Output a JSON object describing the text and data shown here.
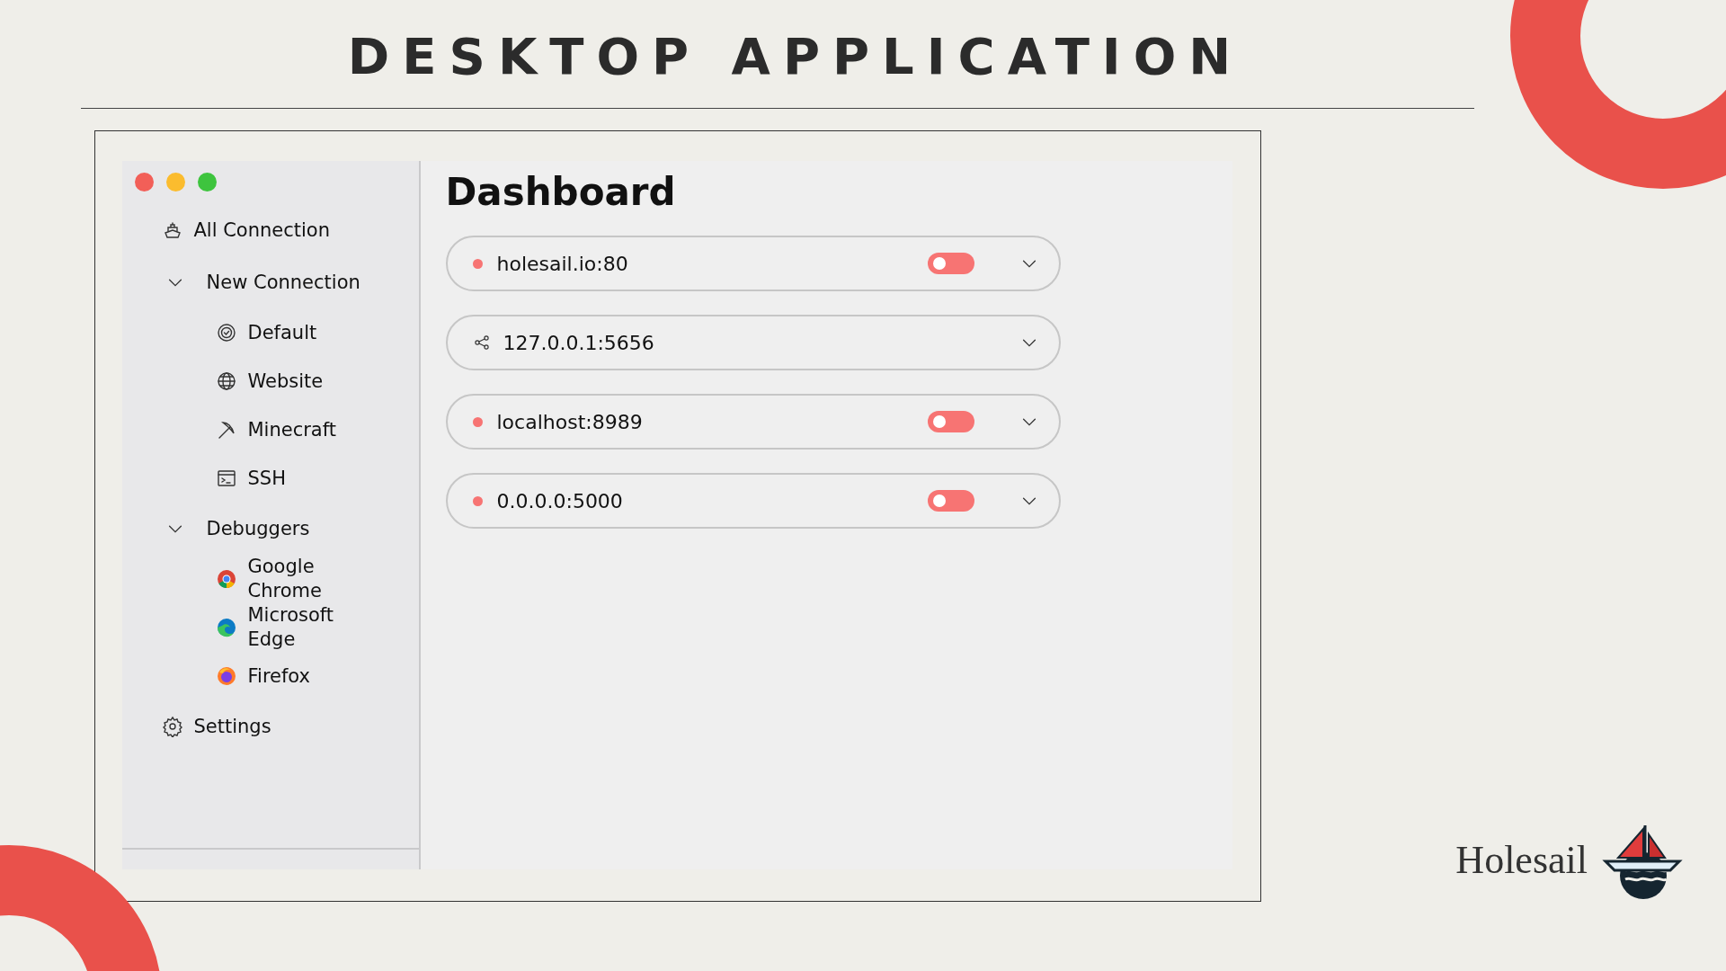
{
  "slide_title": "DESKTOP APPLICATION",
  "window": {
    "traffic_lights": [
      {
        "color": "#f25f58"
      },
      {
        "color": "#fbbc2e"
      },
      {
        "color": "#3ec43e"
      }
    ]
  },
  "sidebar": {
    "items": [
      {
        "label": "All Connection",
        "kind": "link"
      },
      {
        "label": "New Connection",
        "kind": "group",
        "expanded": true,
        "children": [
          {
            "label": "Default"
          },
          {
            "label": "Website"
          },
          {
            "label": "Minecraft"
          },
          {
            "label": "SSH"
          }
        ]
      },
      {
        "label": "Debuggers",
        "kind": "group",
        "expanded": true,
        "children": [
          {
            "label": "Google Chrome"
          },
          {
            "label": "Microsoft Edge"
          },
          {
            "label": "Firefox"
          }
        ]
      },
      {
        "label": "Settings",
        "kind": "link"
      }
    ]
  },
  "dashboard": {
    "title": "Dashboard",
    "connections": [
      {
        "address": "holesail.io:80",
        "kind": "toggle",
        "color": "#f77473",
        "on": false
      },
      {
        "address": "127.0.0.1:5656",
        "kind": "shared"
      },
      {
        "address": "localhost:8989",
        "kind": "toggle",
        "color": "#f77473",
        "on": false
      },
      {
        "address": "0.0.0.0:5000",
        "kind": "toggle",
        "color": "#f77473",
        "on": false
      }
    ]
  },
  "brand": {
    "name": "Holesail"
  }
}
